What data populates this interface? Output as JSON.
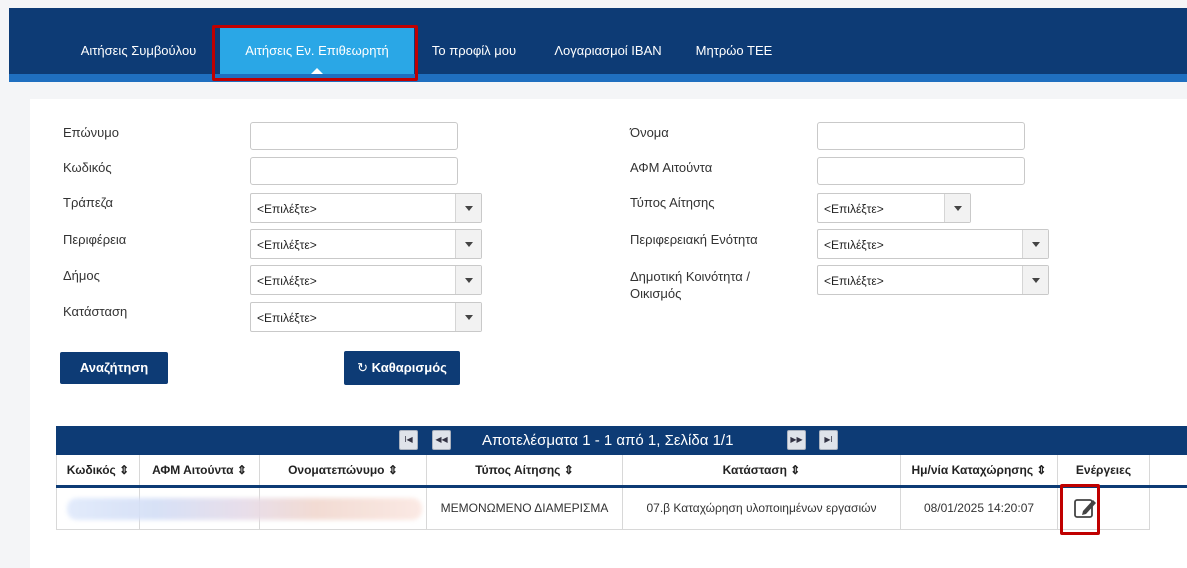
{
  "nav": {
    "items": [
      {
        "label": "Αιτήσεις Συμβούλου"
      },
      {
        "label": "Αιτήσεις Εν. Επιθεωρητή"
      },
      {
        "label": "Το προφίλ μου"
      },
      {
        "label": "Λογαριασμοί IBAN"
      },
      {
        "label": "Μητρώο ΤΕΕ"
      }
    ]
  },
  "filters": {
    "surname_label": "Επώνυμο",
    "code_label": "Κωδικός",
    "bank_label": "Τράπεζα",
    "region_label": "Περιφέρεια",
    "municipality_label": "Δήμος",
    "status_label": "Κατάσταση",
    "name_label": "Όνομα",
    "afm_label": "ΑΦΜ Αιτούντα",
    "request_type_label": "Τύπος Αίτησης",
    "regional_unit_label": "Περιφερειακή Ενότητα",
    "community_label": "Δημοτική Κοινότητα / Οικισμός",
    "select_placeholder": "<Επιλέξτε>"
  },
  "buttons": {
    "search": "Αναζήτηση",
    "clear": "Καθαρισμός",
    "clear_icon": "↻"
  },
  "pager": {
    "text": "Αποτελέσματα 1 - 1 από 1, Σελίδα 1/1",
    "first": "I◀",
    "prev": "◀◀",
    "next": "▶▶",
    "last": "▶I"
  },
  "table": {
    "headers": [
      "Κωδικός ⇕",
      "ΑΦΜ Αιτούντα ⇕",
      "Ονοματεπώνυμο ⇕",
      "Τύπος Αίτησης ⇕",
      "Κατάσταση ⇕",
      "Ημ/νία Καταχώρησης ⇕",
      "Ενέργειες"
    ],
    "rows": [
      {
        "type": "ΜΕΜΟΝΩΜΕΝΟ ΔΙΑΜΕΡΙΣΜΑ",
        "status": "07.β Καταχώρηση υλοποιημένων εργασιών",
        "date": "08/01/2025 14:20:07",
        "action_icon": "edit-icon"
      }
    ]
  },
  "colors": {
    "nav_bg": "#0d3b75",
    "nav_active": "#2aa7e6",
    "highlight": "#c00000"
  }
}
